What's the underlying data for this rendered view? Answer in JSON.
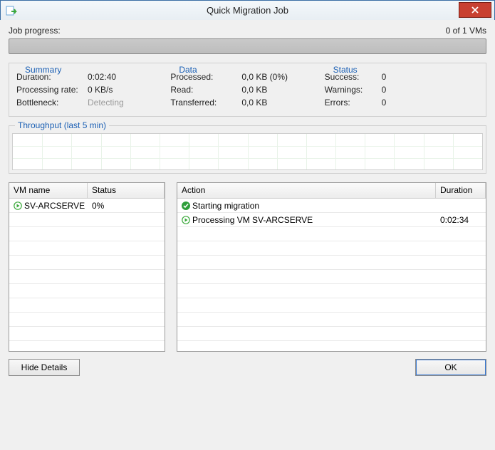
{
  "window": {
    "title": "Quick Migration Job"
  },
  "progress": {
    "label": "Job progress:",
    "status": "0 of 1 VMs"
  },
  "summary": {
    "legend": "Summary",
    "duration_label": "Duration:",
    "duration_value": "0:02:40",
    "rate_label": "Processing rate:",
    "rate_value": "0 KB/s",
    "bottleneck_label": "Bottleneck:",
    "bottleneck_value": "Detecting"
  },
  "data": {
    "legend": "Data",
    "processed_label": "Processed:",
    "processed_value": "0,0 KB (0%)",
    "read_label": "Read:",
    "read_value": "0,0 KB",
    "transferred_label": "Transferred:",
    "transferred_value": "0,0 KB"
  },
  "status": {
    "legend": "Status",
    "success_label": "Success:",
    "success_value": "0",
    "warnings_label": "Warnings:",
    "warnings_value": "0",
    "errors_label": "Errors:",
    "errors_value": "0"
  },
  "throughput": {
    "legend": "Throughput (last 5 min)"
  },
  "vm_grid": {
    "headers": {
      "name": "VM name",
      "status": "Status"
    },
    "rows": [
      {
        "name": "SV-ARCSERVE",
        "status": "0%"
      }
    ]
  },
  "action_grid": {
    "headers": {
      "action": "Action",
      "duration": "Duration"
    },
    "rows": [
      {
        "icon": "check",
        "action": "Starting migration",
        "duration": ""
      },
      {
        "icon": "play",
        "action": "Processing VM SV-ARCSERVE",
        "duration": "0:02:34"
      }
    ]
  },
  "buttons": {
    "hide_details": "Hide Details",
    "ok": "OK"
  }
}
